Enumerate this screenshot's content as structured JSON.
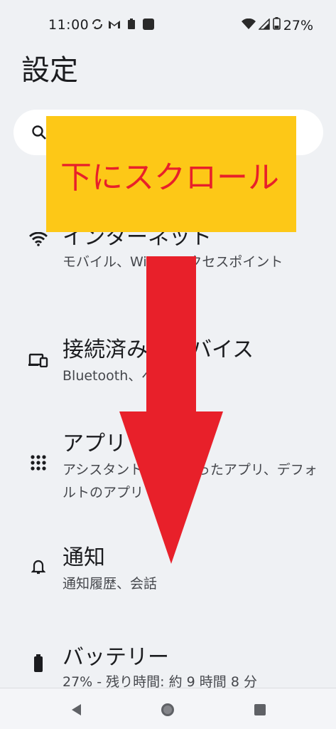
{
  "status": {
    "time": "11:00",
    "battery": "27%"
  },
  "page": {
    "title": "設定"
  },
  "overlay": {
    "label": "下にスクロール",
    "bg_color": "#fdc817",
    "text_color": "#e8202a",
    "arrow_color": "#e8202a"
  },
  "settings": [
    {
      "title": "インターネット",
      "subtitle": "モバイル、Wi-Fi、アクセスポイント",
      "icon": "wifi-icon"
    },
    {
      "title": "接続済みのデバイス",
      "subtitle": "Bluetooth、ペア設定",
      "icon": "devices-icon"
    },
    {
      "title": "アプリ",
      "subtitle": "アシスタント、最近使ったアプリ、デフォルトのアプリ",
      "icon": "apps-grid-icon"
    },
    {
      "title": "通知",
      "subtitle": "通知履歴、会話",
      "icon": "bell-icon"
    },
    {
      "title": "バッテリー",
      "subtitle": "27% - 残り時間: 約 9 時間 8 分",
      "icon": "battery-icon"
    }
  ]
}
